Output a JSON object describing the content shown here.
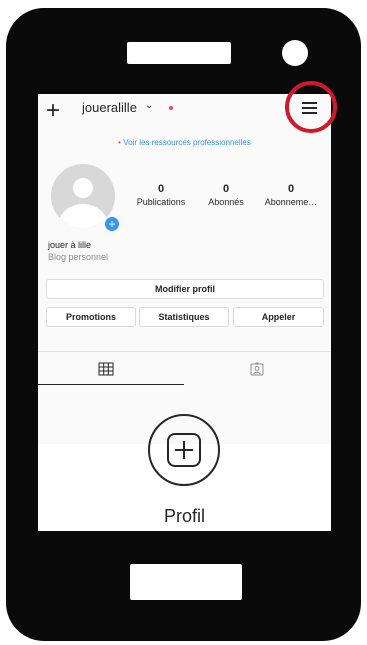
{
  "header": {
    "username": "joueralille",
    "chevron": "⌄"
  },
  "pro_link": {
    "bullet": "•",
    "text": "Voir les ressources professionnelles"
  },
  "profile": {
    "stats": [
      {
        "value": "0",
        "label": "Publications"
      },
      {
        "value": "0",
        "label": "Abonnés"
      },
      {
        "value": "0",
        "label": "Abonneme…"
      }
    ],
    "display_name": "jouer à lille",
    "category": "Blog personnel"
  },
  "actions": {
    "edit_label": "Modifier profil",
    "promotions_label": "Promotions",
    "stats_label": "Statistiques",
    "call_label": "Appeler"
  },
  "empty_state": {
    "title": "Profil"
  },
  "colors": {
    "accent_blue": "#3897f0",
    "notif_red": "#ed4956",
    "highlight_red": "#d01a2c"
  }
}
